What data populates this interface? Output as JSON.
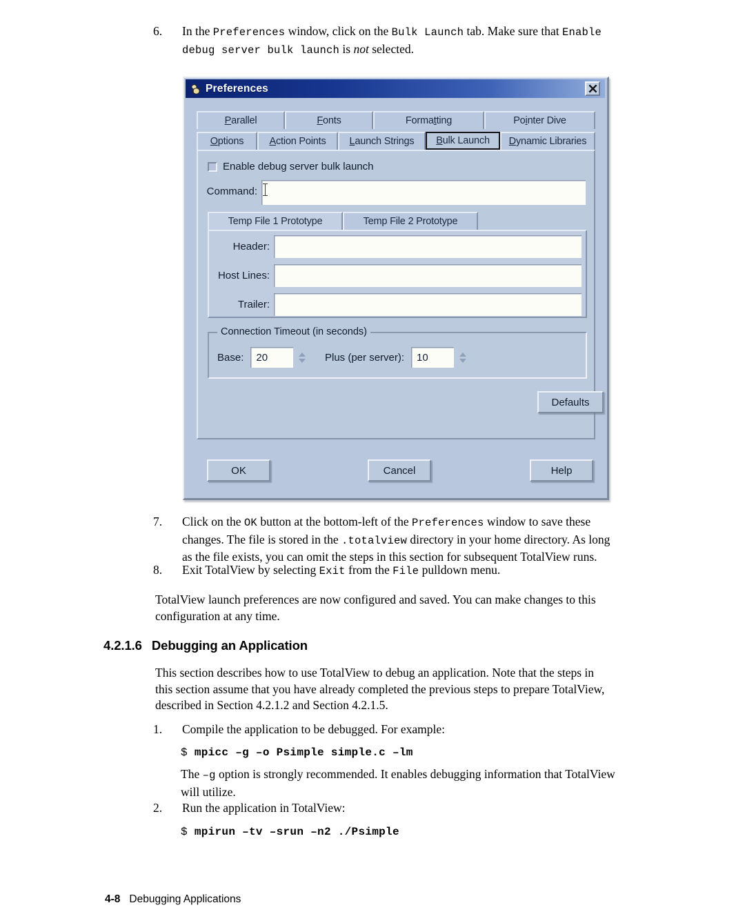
{
  "steps": {
    "step6": {
      "number": "6.",
      "parts": [
        {
          "t": "In the ",
          "s": "n"
        },
        {
          "t": "Preferences",
          "s": "m"
        },
        {
          "t": " window, click on the ",
          "s": "n"
        },
        {
          "t": "Bulk Launch",
          "s": "m"
        },
        {
          "t": " tab. Make sure that ",
          "s": "n"
        },
        {
          "t": "Enable debug server bulk launch",
          "s": "m"
        },
        {
          "t": " is ",
          "s": "n"
        },
        {
          "t": "not",
          "s": "i"
        },
        {
          "t": " selected.",
          "s": "n"
        }
      ],
      "line1_a": "In the ",
      "line1_mono1": "Preferences",
      "line1_b": " window, click on the ",
      "line1_mono2": "Bulk Launch",
      "line1_c": " tab. Make sure that ",
      "line1_mono3": "Enable",
      "line2_mono": "debug server bulk launch",
      "line2_a": " is ",
      "line2_ital": "not",
      "line2_b": " selected."
    },
    "step7": {
      "number": "7.",
      "l1_a": "Click on the ",
      "l1_mono1": "OK",
      "l1_b": " button at the bottom-left of the ",
      "l1_mono2": "Preferences",
      "l1_c": " window to save these",
      "l2_a": "changes. The file is stored in the ",
      "l2_mono": ".totalview",
      "l2_b": " directory in your home directory. As long",
      "l3": "as the file exists, you can omit the steps in this section for subsequent TotalView runs."
    },
    "step8": {
      "number": "8.",
      "l1_a": "Exit TotalView by selecting ",
      "l1_mono1": "Exit",
      "l1_b": " from the ",
      "l1_mono2": "File",
      "l1_c": " pulldown menu."
    },
    "closing": {
      "l1": "TotalView launch preferences are now configured and saved.  You can make changes to this",
      "l2": "configuration at any time."
    }
  },
  "section": {
    "number": "4.2.1.6",
    "title": "Debugging an Application",
    "intro_l1": "This section describes how to use TotalView to debug an application. Note that the steps in",
    "intro_l2": "this section assume that you have already completed the previous steps to prepare TotalView,",
    "intro_l3": "described in Section 4.2.1.2 and Section 4.2.1.5."
  },
  "section_steps": {
    "step1": {
      "number": "1.",
      "text": "Compile the application to be debugged.  For example:"
    },
    "code1": {
      "prompt": "$ ",
      "command": "mpicc –g –o Psimple simple.c –lm"
    },
    "note": {
      "a": "The ",
      "mono": "–g",
      "b": " option is strongly recommended. It enables debugging information that TotalView",
      "l2": "will utilize."
    },
    "step2": {
      "number": "2.",
      "text": "Run the application in TotalView:"
    },
    "code2": {
      "prompt": "$ ",
      "command": "mpirun –tv –srun –n2 ./Psimple"
    }
  },
  "footer": {
    "page": "4-8",
    "title": "Debugging Applications"
  },
  "dialog": {
    "title": "Preferences",
    "close_label": "✕",
    "tabs_row1": [
      {
        "pre": "P",
        "mn": "",
        "label": "Parallel",
        "mn_index": 0
      },
      {
        "label": "Fonts",
        "mn_index": 0
      },
      {
        "label": "Formatting",
        "mn_index": 0
      },
      {
        "label": "Pointer Dive",
        "mn_index": 2
      }
    ],
    "tabs_row1_labels": [
      "Parallel",
      "Fonts",
      "Formatting",
      "Pointer Dive"
    ],
    "tabs_row2_labels": [
      "Options",
      "Action Points",
      "Launch Strings",
      "Bulk Launch",
      "Dynamic Libraries"
    ],
    "selected_tab": "Bulk Launch",
    "checkbox": {
      "label": "Enable debug server bulk launch",
      "checked": false
    },
    "command": {
      "label": "Command:",
      "value": ""
    },
    "inner_tabs": [
      "Temp File 1 Prototype",
      "Temp File 2 Prototype"
    ],
    "inner_selected": "Temp File 1 Prototype",
    "fields": [
      {
        "label": "Header:",
        "value": ""
      },
      {
        "label": "Host Lines:",
        "value": ""
      },
      {
        "label": "Trailer:",
        "value": ""
      }
    ],
    "timeout": {
      "group_title": "Connection Timeout (in seconds)",
      "base_label": "Base:",
      "base_value": "20",
      "plus_label": "Plus (per server):",
      "plus_value": "10"
    },
    "defaults_label": "Defaults",
    "buttons": [
      "OK",
      "Cancel",
      "Help"
    ]
  },
  "colors": {
    "dialog_face": "#bccade",
    "titlebar_start": "#0b2270",
    "titlebar_end": "#93aedb",
    "field_bg": "#fdfdf8",
    "text": "#111a2c"
  }
}
